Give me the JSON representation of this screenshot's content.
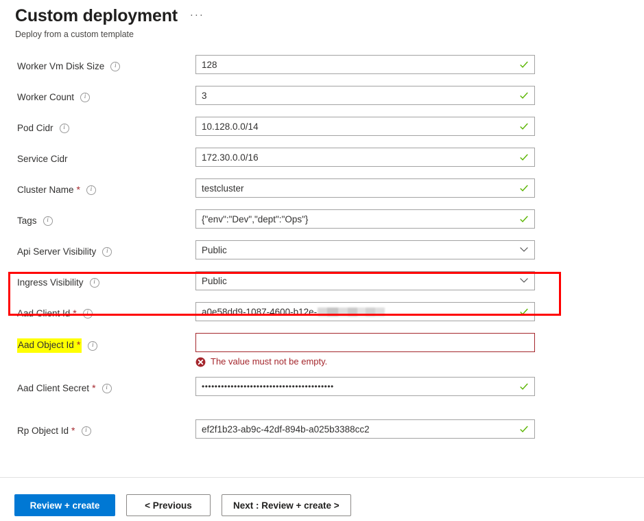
{
  "header": {
    "title": "Custom deployment",
    "subtitle": "Deploy from a custom template",
    "ellipsis": "···"
  },
  "form": {
    "fields": [
      {
        "label": "Worker Vm Disk Size",
        "required": false,
        "info": true,
        "type": "text",
        "value": "128",
        "valid": true
      },
      {
        "label": "Worker Count",
        "required": false,
        "info": true,
        "type": "text",
        "value": "3",
        "valid": true
      },
      {
        "label": "Pod Cidr",
        "required": false,
        "info": true,
        "type": "text",
        "value": "10.128.0.0/14",
        "valid": true
      },
      {
        "label": "Service Cidr",
        "required": false,
        "info": false,
        "type": "text",
        "value": "172.30.0.0/16",
        "valid": true
      },
      {
        "label": "Cluster Name",
        "required": true,
        "info": true,
        "type": "text",
        "value": "testcluster",
        "valid": true
      },
      {
        "label": "Tags",
        "required": false,
        "info": true,
        "type": "text",
        "value": "{\"env\":\"Dev\",\"dept\":\"Ops\"}",
        "valid": true
      },
      {
        "label": "Api Server Visibility",
        "required": false,
        "info": true,
        "type": "select",
        "value": "Public",
        "valid": false
      },
      {
        "label": "Ingress Visibility",
        "required": false,
        "info": true,
        "type": "select",
        "value": "Public",
        "valid": false
      },
      {
        "label": "Aad Client Id",
        "required": true,
        "info": true,
        "type": "redacted",
        "value": "a0e58dd9-1087-4600-b12e-",
        "valid": true
      },
      {
        "label": "Aad Object Id",
        "required": true,
        "info": true,
        "type": "text",
        "value": "",
        "valid": false,
        "highlighted": true,
        "error": "The value must not be empty."
      },
      {
        "label": "Aad Client Secret",
        "required": true,
        "info": true,
        "type": "password",
        "value": "•••••••••••••••••••••••••••••••••••••••••",
        "valid": true
      },
      {
        "label": "Rp Object Id",
        "required": true,
        "info": true,
        "type": "text",
        "value": "ef2f1b23-ab9c-42df-894b-a025b3388cc2",
        "valid": true
      }
    ],
    "required_marker": "*",
    "info_glyph": "i"
  },
  "footer": {
    "review_create_label": "Review + create",
    "previous_label": "< Previous",
    "next_label": "Next : Review + create >"
  },
  "colors": {
    "primary": "#0078d4",
    "error": "#a4262c",
    "highlight_box": "#ff0000",
    "highlight_text": "#ffff00",
    "valid_check": "#5ab500"
  }
}
